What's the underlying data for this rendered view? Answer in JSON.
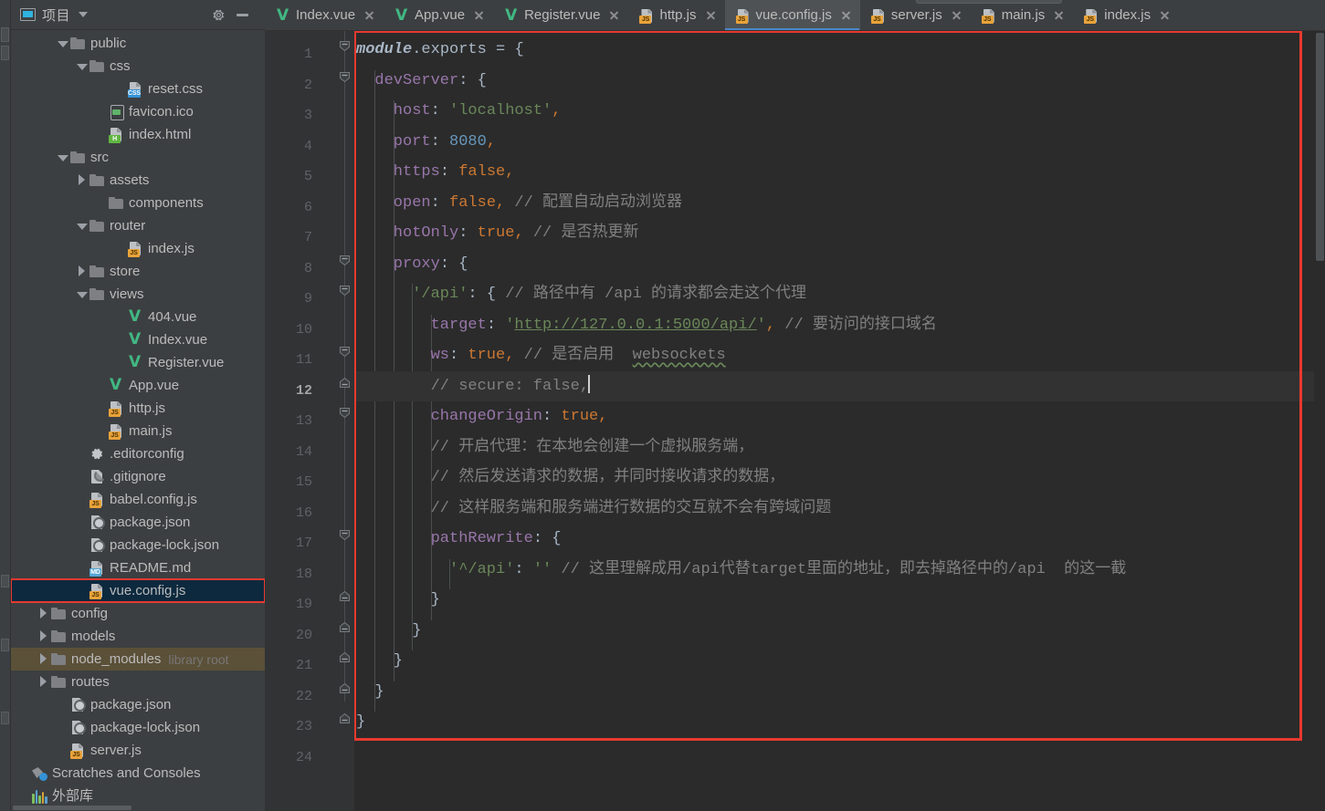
{
  "window": {
    "theme_bg": "#3c3f41",
    "editor_bg": "#2b2b2b",
    "accent": "#4a88c7",
    "annotation_color": "#e8392f"
  },
  "project_panel": {
    "title": "项目",
    "title_icon": "project-window-icon",
    "dropdown_icon": "chevron-down-icon",
    "settings_icon": "gear-icon",
    "hide_icon": "minimize-icon",
    "tree": [
      {
        "label": "public",
        "indent": 2,
        "icon": "folder-icon",
        "twisty": "open",
        "state": ""
      },
      {
        "label": "css",
        "indent": 3,
        "icon": "folder-icon",
        "twisty": "open",
        "state": ""
      },
      {
        "label": "reset.css",
        "indent": 5,
        "icon": "css-file-icon",
        "twisty": "none",
        "state": ""
      },
      {
        "label": "favicon.ico",
        "indent": 4,
        "icon": "image-file-icon",
        "twisty": "none",
        "state": ""
      },
      {
        "label": "index.html",
        "indent": 4,
        "icon": "html-file-icon",
        "twisty": "none",
        "state": ""
      },
      {
        "label": "src",
        "indent": 2,
        "icon": "folder-icon",
        "twisty": "open",
        "state": ""
      },
      {
        "label": "assets",
        "indent": 3,
        "icon": "folder-icon",
        "twisty": "closed",
        "state": ""
      },
      {
        "label": "components",
        "indent": 4,
        "icon": "folder-icon",
        "twisty": "none",
        "state": ""
      },
      {
        "label": "router",
        "indent": 3,
        "icon": "folder-icon",
        "twisty": "open",
        "state": ""
      },
      {
        "label": "index.js",
        "indent": 5,
        "icon": "js-file-icon",
        "twisty": "none",
        "state": ""
      },
      {
        "label": "store",
        "indent": 3,
        "icon": "folder-icon",
        "twisty": "closed",
        "state": ""
      },
      {
        "label": "views",
        "indent": 3,
        "icon": "folder-icon",
        "twisty": "open",
        "state": ""
      },
      {
        "label": "404.vue",
        "indent": 5,
        "icon": "vue-file-icon",
        "twisty": "none",
        "state": ""
      },
      {
        "label": "Index.vue",
        "indent": 5,
        "icon": "vue-file-icon",
        "twisty": "none",
        "state": ""
      },
      {
        "label": "Register.vue",
        "indent": 5,
        "icon": "vue-file-icon",
        "twisty": "none",
        "state": ""
      },
      {
        "label": "App.vue",
        "indent": 4,
        "icon": "vue-file-icon",
        "twisty": "none",
        "state": ""
      },
      {
        "label": "http.js",
        "indent": 4,
        "icon": "js-file-icon",
        "twisty": "none",
        "state": ""
      },
      {
        "label": "main.js",
        "indent": 4,
        "icon": "js-file-icon",
        "twisty": "none",
        "state": ""
      },
      {
        "label": ".editorconfig",
        "indent": 3,
        "icon": "gear-file-icon",
        "twisty": "none",
        "state": ""
      },
      {
        "label": ".gitignore",
        "indent": 3,
        "icon": "gitignore-file-icon",
        "twisty": "none",
        "state": ""
      },
      {
        "label": "babel.config.js",
        "indent": 3,
        "icon": "js-file-icon",
        "twisty": "none",
        "state": ""
      },
      {
        "label": "package.json",
        "indent": 3,
        "icon": "json-file-icon",
        "twisty": "none",
        "state": ""
      },
      {
        "label": "package-lock.json",
        "indent": 3,
        "icon": "json-file-icon",
        "twisty": "none",
        "state": ""
      },
      {
        "label": "README.md",
        "indent": 3,
        "icon": "md-file-icon",
        "twisty": "none",
        "state": ""
      },
      {
        "label": "vue.config.js",
        "indent": 3,
        "icon": "js-file-icon",
        "twisty": "none",
        "state": "selected-highlighted"
      },
      {
        "label": "config",
        "indent": 1,
        "icon": "folder-icon",
        "twisty": "closed",
        "state": ""
      },
      {
        "label": "models",
        "indent": 1,
        "icon": "folder-icon",
        "twisty": "closed",
        "state": ""
      },
      {
        "label": "node_modules",
        "indent": 1,
        "icon": "folder-icon",
        "twisty": "closed",
        "state": "hovered",
        "suffix": "library root"
      },
      {
        "label": "routes",
        "indent": 1,
        "icon": "folder-icon",
        "twisty": "closed",
        "state": ""
      },
      {
        "label": "package.json",
        "indent": 2,
        "icon": "json-file-icon",
        "twisty": "none",
        "state": ""
      },
      {
        "label": "package-lock.json",
        "indent": 2,
        "icon": "json-file-icon",
        "twisty": "none",
        "state": ""
      },
      {
        "label": "server.js",
        "indent": 2,
        "icon": "js-file-icon",
        "twisty": "none",
        "state": ""
      },
      {
        "label": "Scratches and Consoles",
        "indent": 0,
        "icon": "scratches-icon",
        "twisty": "none",
        "state": ""
      },
      {
        "label": "外部库",
        "indent": 0,
        "icon": "external-libraries-icon",
        "twisty": "none",
        "state": ""
      }
    ]
  },
  "editor": {
    "tabs": [
      {
        "label": "Index.vue",
        "icon": "vue-file-icon",
        "active": false
      },
      {
        "label": "App.vue",
        "icon": "vue-file-icon",
        "active": false
      },
      {
        "label": "Register.vue",
        "icon": "vue-file-icon",
        "active": false
      },
      {
        "label": "http.js",
        "icon": "js-file-icon",
        "active": false
      },
      {
        "label": "vue.config.js",
        "icon": "js-file-icon",
        "active": true
      },
      {
        "label": "server.js",
        "icon": "js-file-icon",
        "active": false
      },
      {
        "label": "main.js",
        "icon": "js-file-icon",
        "active": false
      },
      {
        "label": "index.js",
        "icon": "js-file-icon",
        "active": false
      }
    ],
    "close_icon": "close-icon",
    "current_line": 12,
    "total_lines": 24,
    "line_numbers": [
      1,
      2,
      3,
      4,
      5,
      6,
      7,
      8,
      9,
      10,
      11,
      12,
      13,
      14,
      15,
      16,
      17,
      18,
      19,
      20,
      21,
      22,
      23,
      24
    ],
    "fold_lines": [
      1,
      2,
      8,
      9,
      11,
      12,
      13,
      17,
      19,
      20,
      21,
      22,
      23
    ],
    "intention_bulb": {
      "line": 12,
      "icon": "lightbulb-icon"
    },
    "code_lines": [
      {
        "n": 1,
        "indent": 0,
        "segments": [
          {
            "t": "mod",
            "v": "module"
          },
          {
            "t": "punc",
            "v": "."
          },
          {
            "t": "plain",
            "v": "exports"
          },
          {
            "t": "plain",
            "v": " = "
          },
          {
            "t": "punc",
            "v": "{"
          }
        ]
      },
      {
        "n": 2,
        "indent": 1,
        "segments": [
          {
            "t": "prop",
            "v": "devServer"
          },
          {
            "t": "punc",
            "v": ": {"
          }
        ]
      },
      {
        "n": 3,
        "indent": 2,
        "segments": [
          {
            "t": "prop",
            "v": "host"
          },
          {
            "t": "punc",
            "v": ": "
          },
          {
            "t": "str",
            "v": "'localhost'"
          },
          {
            "t": "comma",
            "v": ","
          }
        ]
      },
      {
        "n": 4,
        "indent": 2,
        "segments": [
          {
            "t": "prop",
            "v": "port"
          },
          {
            "t": "punc",
            "v": ": "
          },
          {
            "t": "num",
            "v": "8080"
          },
          {
            "t": "comma",
            "v": ","
          }
        ]
      },
      {
        "n": 5,
        "indent": 2,
        "segments": [
          {
            "t": "prop",
            "v": "https"
          },
          {
            "t": "punc",
            "v": ": "
          },
          {
            "t": "kw",
            "v": "false"
          },
          {
            "t": "comma",
            "v": ","
          }
        ]
      },
      {
        "n": 6,
        "indent": 2,
        "segments": [
          {
            "t": "prop",
            "v": "open"
          },
          {
            "t": "punc",
            "v": ": "
          },
          {
            "t": "kw",
            "v": "false"
          },
          {
            "t": "comma",
            "v": ","
          },
          {
            "t": "cmt",
            "v": " // 配置自动启动浏览器"
          }
        ]
      },
      {
        "n": 7,
        "indent": 2,
        "segments": [
          {
            "t": "prop",
            "v": "hotOnly"
          },
          {
            "t": "punc",
            "v": ": "
          },
          {
            "t": "kw",
            "v": "true"
          },
          {
            "t": "comma",
            "v": ","
          },
          {
            "t": "cmt",
            "v": " // 是否热更新"
          }
        ]
      },
      {
        "n": 8,
        "indent": 2,
        "segments": [
          {
            "t": "prop",
            "v": "proxy"
          },
          {
            "t": "punc",
            "v": ": {"
          }
        ]
      },
      {
        "n": 9,
        "indent": 3,
        "segments": [
          {
            "t": "str",
            "v": "'/api'"
          },
          {
            "t": "punc",
            "v": ": { "
          },
          {
            "t": "cmt",
            "v": "// 路径中有 /api 的请求都会走这个代理"
          }
        ]
      },
      {
        "n": 10,
        "indent": 4,
        "segments": [
          {
            "t": "prop",
            "v": "target"
          },
          {
            "t": "punc",
            "v": ": "
          },
          {
            "t": "str",
            "v": "'"
          },
          {
            "t": "link",
            "v": "http://127.0.0.1:5000/api/"
          },
          {
            "t": "str",
            "v": "'"
          },
          {
            "t": "comma",
            "v": ","
          },
          {
            "t": "cmt",
            "v": " // 要访问的接口域名"
          }
        ]
      },
      {
        "n": 11,
        "indent": 4,
        "segments": [
          {
            "t": "prop",
            "v": "ws"
          },
          {
            "t": "punc",
            "v": ": "
          },
          {
            "t": "kw",
            "v": "true"
          },
          {
            "t": "comma",
            "v": ","
          },
          {
            "t": "cmt",
            "v": " // 是否启用  "
          },
          {
            "t": "cmt-sq",
            "v": "websockets"
          }
        ]
      },
      {
        "n": 12,
        "indent": 4,
        "segments": [
          {
            "t": "cmt",
            "v": "// secure: false,"
          },
          {
            "t": "caret",
            "v": ""
          }
        ]
      },
      {
        "n": 13,
        "indent": 4,
        "segments": [
          {
            "t": "prop",
            "v": "changeOrigin"
          },
          {
            "t": "punc",
            "v": ": "
          },
          {
            "t": "kw",
            "v": "true"
          },
          {
            "t": "comma",
            "v": ","
          }
        ]
      },
      {
        "n": 14,
        "indent": 4,
        "segments": [
          {
            "t": "cmt",
            "v": "// 开启代理：在本地会创建一个虚拟服务端，"
          }
        ]
      },
      {
        "n": 15,
        "indent": 4,
        "segments": [
          {
            "t": "cmt",
            "v": "// 然后发送请求的数据，并同时接收请求的数据，"
          }
        ]
      },
      {
        "n": 16,
        "indent": 4,
        "segments": [
          {
            "t": "cmt",
            "v": "// 这样服务端和服务端进行数据的交互就不会有跨域问题"
          }
        ]
      },
      {
        "n": 17,
        "indent": 4,
        "segments": [
          {
            "t": "prop",
            "v": "pathRewrite"
          },
          {
            "t": "punc",
            "v": ": {"
          }
        ]
      },
      {
        "n": 18,
        "indent": 5,
        "segments": [
          {
            "t": "str",
            "v": "'^/api'"
          },
          {
            "t": "punc",
            "v": ": "
          },
          {
            "t": "str",
            "v": "''"
          },
          {
            "t": "cmt",
            "v": " // 这里理解成用/api代替target里面的地址，即去掉路径中的/api  的这一截"
          }
        ]
      },
      {
        "n": 19,
        "indent": 4,
        "segments": [
          {
            "t": "punc",
            "v": "}"
          }
        ]
      },
      {
        "n": 20,
        "indent": 3,
        "segments": [
          {
            "t": "punc",
            "v": "}"
          }
        ]
      },
      {
        "n": 21,
        "indent": 2,
        "segments": [
          {
            "t": "punc",
            "v": "}"
          }
        ]
      },
      {
        "n": 22,
        "indent": 1,
        "segments": [
          {
            "t": "punc",
            "v": "}"
          }
        ]
      },
      {
        "n": 23,
        "indent": 0,
        "segments": [
          {
            "t": "punc",
            "v": "}"
          }
        ]
      },
      {
        "n": 24,
        "indent": 0,
        "segments": []
      }
    ],
    "annotation_rect": {
      "line_start": 1,
      "line_end": 23,
      "color": "#e8392f"
    }
  }
}
